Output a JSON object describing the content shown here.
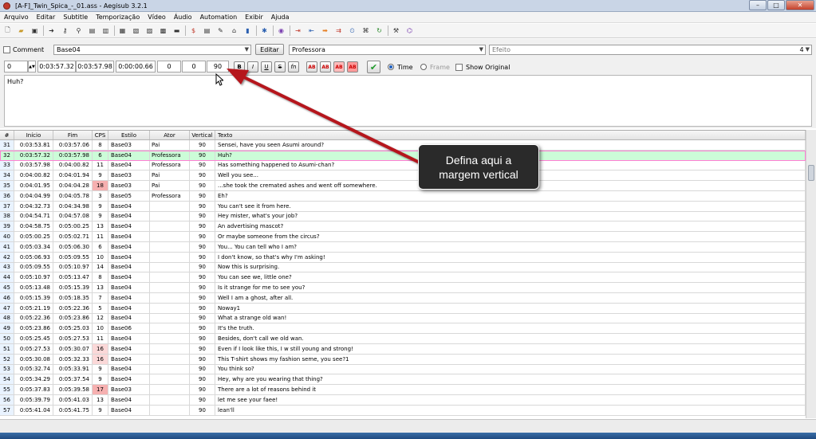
{
  "window": {
    "title": "[A-F]_Twin_Spica_-_01.ass - Aegisub 3.2.1"
  },
  "menu": [
    "Arquivo",
    "Editar",
    "Subtitle",
    "Temporização",
    "Vídeo",
    "Áudio",
    "Automation",
    "Exibir",
    "Ajuda"
  ],
  "editor": {
    "comment_label": "Comment",
    "style": "Base04",
    "edit_button": "Editar",
    "actor": "Professora",
    "effect": "Efeito",
    "layer_right": "4",
    "layer": "0",
    "start": "0:03:57.32",
    "end": "0:03:57.98",
    "duration": "0:00:00.66",
    "margin_left": "0",
    "margin_right": "0",
    "margin_vertical": "90",
    "bold": "B",
    "italic": "I",
    "underline": "U",
    "strike": "S",
    "font": "fn",
    "color_ab": "AB",
    "time_label": "Time",
    "frame_label": "Frame",
    "show_original_label": "Show Original",
    "text": "Huh?"
  },
  "grid": {
    "headers": {
      "num": "#",
      "start": "Início",
      "end": "Fim",
      "cps": "CPS",
      "style": "Estilo",
      "actor": "Ator",
      "vertical": "Vertical",
      "text": "Texto"
    },
    "rows": [
      {
        "num": "31",
        "start": "0:03:53.81",
        "end": "0:03:57.06",
        "cps": "8",
        "style": "Base03",
        "actor": "Pai",
        "vertical": "90",
        "text": "Sensei, have you seen Asumi around?"
      },
      {
        "num": "32",
        "start": "0:03:57.32",
        "end": "0:03:57.98",
        "cps": "6",
        "style": "Base04",
        "actor": "Professora",
        "vertical": "90",
        "text": "Huh?"
      },
      {
        "num": "33",
        "start": "0:03:57.98",
        "end": "0:04:00.82",
        "cps": "11",
        "style": "Base04",
        "actor": "Professora",
        "vertical": "90",
        "text": "Has something happened to Asumi-chan?"
      },
      {
        "num": "34",
        "start": "0:04:00.82",
        "end": "0:04:01.94",
        "cps": "9",
        "style": "Base03",
        "actor": "Pai",
        "vertical": "90",
        "text": "Well you see..."
      },
      {
        "num": "35",
        "start": "0:04:01.95",
        "end": "0:04:04.28",
        "cps": "18",
        "style": "Base03",
        "actor": "Pai",
        "vertical": "90",
        "text": "...she took the cremated ashes and went off somewhere."
      },
      {
        "num": "36",
        "start": "0:04:04.99",
        "end": "0:04:05.78",
        "cps": "3",
        "style": "Base05",
        "actor": "Professora",
        "vertical": "90",
        "text": "Eh?"
      },
      {
        "num": "37",
        "start": "0:04:32.73",
        "end": "0:04:34.98",
        "cps": "9",
        "style": "Base04",
        "actor": "",
        "vertical": "90",
        "text": "You can't see it from here."
      },
      {
        "num": "38",
        "start": "0:04:54.71",
        "end": "0:04:57.08",
        "cps": "9",
        "style": "Base04",
        "actor": "",
        "vertical": "90",
        "text": "Hey mister, what's your job?"
      },
      {
        "num": "39",
        "start": "0:04:58.75",
        "end": "0:05:00.25",
        "cps": "13",
        "style": "Base04",
        "actor": "",
        "vertical": "90",
        "text": "An advertising mascot?"
      },
      {
        "num": "40",
        "start": "0:05:00.25",
        "end": "0:05:02.71",
        "cps": "11",
        "style": "Base04",
        "actor": "",
        "vertical": "90",
        "text": "Or maybe someone from the circus?"
      },
      {
        "num": "41",
        "start": "0:05:03.34",
        "end": "0:05:06.30",
        "cps": "6",
        "style": "Base04",
        "actor": "",
        "vertical": "90",
        "text": "You... You can tell who I am?"
      },
      {
        "num": "42",
        "start": "0:05:06.93",
        "end": "0:05:09.55",
        "cps": "10",
        "style": "Base04",
        "actor": "",
        "vertical": "90",
        "text": "I don't know, so that's why I'm asking!"
      },
      {
        "num": "43",
        "start": "0:05:09.55",
        "end": "0:05:10.97",
        "cps": "14",
        "style": "Base04",
        "actor": "",
        "vertical": "90",
        "text": "Now this is surprising."
      },
      {
        "num": "44",
        "start": "0:05:10.97",
        "end": "0:05:13.47",
        "cps": "8",
        "style": "Base04",
        "actor": "",
        "vertical": "90",
        "text": "You can see we, little one?"
      },
      {
        "num": "45",
        "start": "0:05:13.48",
        "end": "0:05:15.39",
        "cps": "13",
        "style": "Base04",
        "actor": "",
        "vertical": "90",
        "text": "Is it strange for me to see you?"
      },
      {
        "num": "46",
        "start": "0:05:15.39",
        "end": "0:05:18.35",
        "cps": "7",
        "style": "Base04",
        "actor": "",
        "vertical": "90",
        "text": "Well I am a ghost, after all."
      },
      {
        "num": "47",
        "start": "0:05:21.19",
        "end": "0:05:22.36",
        "cps": "5",
        "style": "Base04",
        "actor": "",
        "vertical": "90",
        "text": "Noway1"
      },
      {
        "num": "48",
        "start": "0:05:22.36",
        "end": "0:05:23.86",
        "cps": "12",
        "style": "Base04",
        "actor": "",
        "vertical": "90",
        "text": "What a strange old wan!"
      },
      {
        "num": "49",
        "start": "0:05:23.86",
        "end": "0:05:25.03",
        "cps": "10",
        "style": "Base06",
        "actor": "",
        "vertical": "90",
        "text": "It's the truth."
      },
      {
        "num": "50",
        "start": "0:05:25.45",
        "end": "0:05:27.53",
        "cps": "11",
        "style": "Base04",
        "actor": "",
        "vertical": "90",
        "text": "Besides, don't call we old wan."
      },
      {
        "num": "51",
        "start": "0:05:27.53",
        "end": "0:05:30.07",
        "cps": "16",
        "style": "Base04",
        "actor": "",
        "vertical": "90",
        "text": "Even if I look like this, I w still young and strong!"
      },
      {
        "num": "52",
        "start": "0:05:30.08",
        "end": "0:05:32.33",
        "cps": "16",
        "style": "Base04",
        "actor": "",
        "vertical": "90",
        "text": "This T-shirt shows my fashion seme, you see?1"
      },
      {
        "num": "53",
        "start": "0:05:32.74",
        "end": "0:05:33.91",
        "cps": "9",
        "style": "Base04",
        "actor": "",
        "vertical": "90",
        "text": "You think so?"
      },
      {
        "num": "54",
        "start": "0:05:34.29",
        "end": "0:05:37.54",
        "cps": "9",
        "style": "Base04",
        "actor": "",
        "vertical": "90",
        "text": "Hey, why are you wearing that thing?"
      },
      {
        "num": "55",
        "start": "0:05:37.83",
        "end": "0:05:39.58",
        "cps": "17",
        "style": "Base03",
        "actor": "",
        "vertical": "90",
        "text": "There are a lot of reasons behind it"
      },
      {
        "num": "56",
        "start": "0:05:39.79",
        "end": "0:05:41.03",
        "cps": "13",
        "style": "Base04",
        "actor": "",
        "vertical": "90",
        "text": "let me see your faee!"
      },
      {
        "num": "57",
        "start": "0:05:41.04",
        "end": "0:05:41.75",
        "cps": "9",
        "style": "Base04",
        "actor": "",
        "vertical": "90",
        "text": "lean'll"
      }
    ]
  },
  "callout": {
    "line1": "Defina aqui a",
    "line2": "margem vertical"
  },
  "colors": {
    "selected_row": "#ccfcd8",
    "cps_high": "#f6b0b0",
    "arrow": "#b5121b"
  },
  "icons": [
    "new-file-icon",
    "open-file-icon",
    "save-icon",
    "bold-icon",
    "italic-icon",
    "commit-check-icon"
  ]
}
